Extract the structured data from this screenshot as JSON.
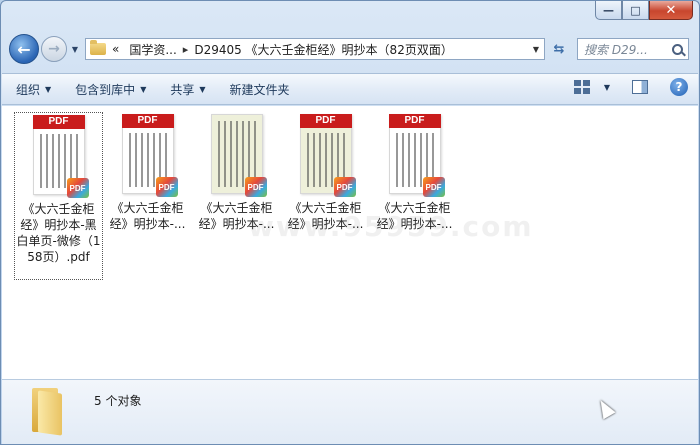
{
  "caption": {
    "minimize_glyph": "—",
    "maximize_glyph": "□",
    "close_glyph": "✕"
  },
  "address": {
    "chevron": "«",
    "crumbs": [
      "国学资...",
      "D29405 《大六壬金柜经》明抄本（82页双面）"
    ],
    "separator": "▸"
  },
  "search": {
    "placeholder": "搜索 D29..."
  },
  "toolbar": {
    "organize": "组织",
    "include_library": "包含到库中",
    "share": "共享",
    "new_folder": "新建文件夹"
  },
  "files": [
    {
      "name": "《大六壬金柜经》明抄本-黑白单页-微修（158页）.pdf",
      "style": "white",
      "selected": true
    },
    {
      "name": "《大六壬金柜经》明抄本-...",
      "style": "white",
      "selected": false
    },
    {
      "name": "《大六壬金柜经》明抄本-...",
      "style": "green",
      "selected": false
    },
    {
      "name": "《大六壬金柜经》明抄本-...",
      "style": "green",
      "selected": false
    },
    {
      "name": "《大六壬金柜经》明抄本-...",
      "style": "white",
      "selected": false
    }
  ],
  "thumb": {
    "header": "PDF",
    "badge": "PDF"
  },
  "watermark": "www.95959.com",
  "details": {
    "count_text": "5 个对象"
  }
}
